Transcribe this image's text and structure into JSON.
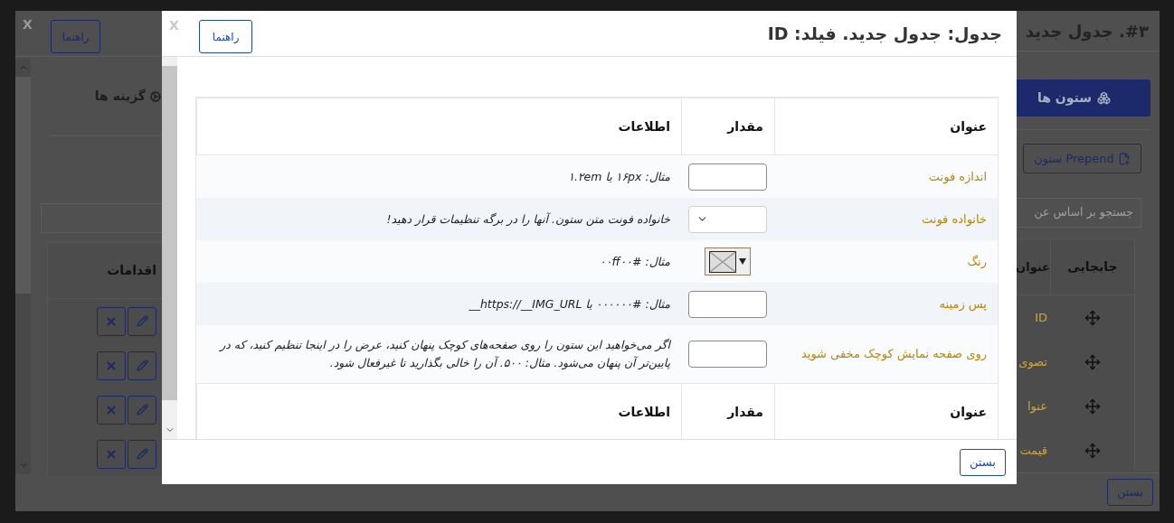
{
  "background_dialog": {
    "close_label": "X",
    "title": "#۳. جدول جدید",
    "help_button": "راهنما",
    "options_heading": "گزینه ها",
    "columns_button": "ستون ها",
    "prepend_button": "Prepend ستون",
    "search": {
      "placeholder": "جستجو بر اساس عن"
    },
    "table": {
      "columns": [
        {
          "label": "جابجایی"
        },
        {
          "label": "عنوان"
        },
        {
          "label": "اقدامات"
        }
      ],
      "rows": [
        {
          "title": "ID"
        },
        {
          "title": "تصوی"
        },
        {
          "title": "عنوا"
        },
        {
          "title": "قیمت"
        }
      ]
    },
    "close_button": "بستن"
  },
  "modal": {
    "close_label": "X",
    "title": "جدول: جدول جدید. فیلد: ID",
    "help_button": "راهنما",
    "table": {
      "columns": [
        {
          "label": "عنوان"
        },
        {
          "label": "مقدار"
        },
        {
          "label": "اطلاعات"
        }
      ],
      "rows": [
        {
          "kind": "text",
          "label": "اندازه فونت",
          "info": "مثال: ۱۶px یا ۱.۲em"
        },
        {
          "kind": "select",
          "label": "خانواده فونت",
          "info": "خانواده فونت متن ستون. آنها را در برگه تنظیمات قرار دهید!"
        },
        {
          "kind": "color",
          "label": "رنگ",
          "info": "مثال: #۰۰ff۰۰"
        },
        {
          "kind": "text",
          "label": "پس زمینه",
          "info": "مثال: #۰۰۰۰۰۰ یا https://__IMG_URL__"
        },
        {
          "kind": "text",
          "label": "روی صفحه نمایش کوچک مخفی شوید",
          "info": "اگر می‌خواهید این ستون را روی صفحه‌های کوچک پنهان کنید، عرض را در اینجا تنظیم کنید، که در پایین‌تر آن پنهان می‌شود. مثال: ۵۰۰. آن را خالی بگذارید تا غیرفعال شود."
        }
      ],
      "footer_columns": [
        {
          "label": "عنوان"
        },
        {
          "label": "مقدار"
        },
        {
          "label": "اطلاعات"
        }
      ]
    },
    "close_button": "بستن"
  }
}
